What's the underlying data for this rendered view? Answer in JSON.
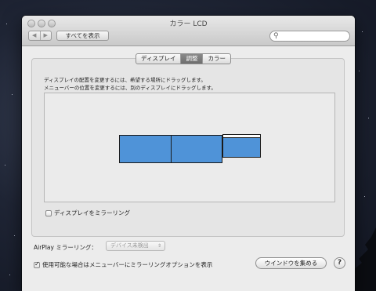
{
  "window": {
    "title": "カラー LCD"
  },
  "toolbar": {
    "back": "◀",
    "forward": "▶",
    "show_all": "すべてを表示",
    "search_placeholder": ""
  },
  "tabs": [
    {
      "label": "ディスプレイ",
      "active": false
    },
    {
      "label": "調整",
      "active": true
    },
    {
      "label": "カラー",
      "active": false
    }
  ],
  "arrangement": {
    "instruction_1": "ディスプレイの配置を変更するには、希望する場所にドラッグします。",
    "instruction_2": "メニューバーの位置を変更するには、別のディスプレイにドラッグします。",
    "display_color": "#4f93d8"
  },
  "mirror": {
    "label": "ディスプレイをミラーリング",
    "checked": false
  },
  "airplay": {
    "label": "AirPlay ミラーリング：",
    "value": "デバイス未検出"
  },
  "menu_option": {
    "label": "使用可能な場合はメニューバーにミラーリングオプションを表示",
    "checked": true
  },
  "buttons": {
    "gather": "ウインドウを集める",
    "help": "?"
  }
}
